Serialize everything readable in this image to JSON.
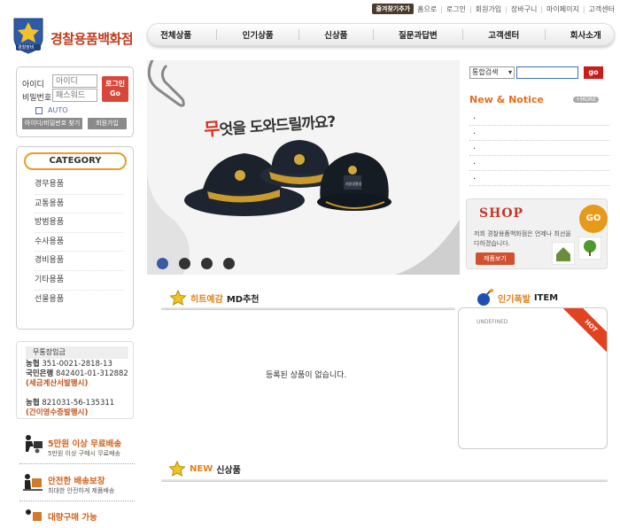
{
  "util_nav": {
    "favorite": "즐겨찾기추가",
    "items": [
      "홈으로",
      "로그인",
      "회원가입",
      "장바구니",
      "마이페이지",
      "고객센터"
    ]
  },
  "logo": {
    "badge_text": "경찰장비",
    "site_name": "경찰용품백화점"
  },
  "nav": [
    "전체상품",
    "인기상품",
    "신상품",
    "질문과답변",
    "고객센터",
    "회사소개"
  ],
  "login": {
    "id_label": "아이디",
    "id_placeholder": "아이디",
    "pw_label": "비밀번호",
    "pw_placeholder": "패스워드",
    "login_button_1": "로그인",
    "login_button_2": "Go",
    "auto": "AUTO",
    "find_button": "아이디/비밀번호 찾기",
    "join_button": "회원가입"
  },
  "category": {
    "title": "CATEGORY",
    "items": [
      "경무용품",
      "교통용품",
      "방범용품",
      "수사용품",
      "경비용품",
      "기타용품",
      "선물용품"
    ]
  },
  "bank": {
    "title": "무통장입금",
    "nh1": "농협",
    "nh1_num": "351-0021-2818-13",
    "km": "국민은행",
    "km_num": "842401-01-312882",
    "note1": "(세금계산서발행시)",
    "nh2": "농협",
    "nh2_num": "821031-56-135311",
    "note2": "(간이영수증발행시)"
  },
  "services": [
    {
      "title": "5만원 이상 무료배송",
      "sub": "5만원 이상 구매시 무료배송"
    },
    {
      "title": "안전한 배송보장",
      "sub": "최대한 안전하게 제품배송"
    },
    {
      "title": "대량구매 가능",
      "sub": ""
    }
  ],
  "banner": {
    "headline_first": "무",
    "headline_rest": "엇을 도와드릴까요?",
    "hat_badge": "지방경찰청"
  },
  "search": {
    "select": "통합검색",
    "go": "go"
  },
  "news": {
    "title": "New & Notice",
    "more": "+MORE",
    "items": [
      ".",
      ".",
      ".",
      ".",
      "."
    ]
  },
  "shop": {
    "title": "SHOP",
    "go": "GO",
    "desc": "저희 경찰용품백화점은 언제나 최선을 다하겠습니다.",
    "button": "제품보기"
  },
  "md": {
    "title_o": "히트예감",
    "title": "MD추천",
    "empty": "등록된 상품이 없습니다."
  },
  "hot": {
    "title_o": "인기폭발",
    "title": "ITEM",
    "ribbon": "HOT",
    "placeholder": "UNDEFINED"
  },
  "newitems": {
    "title_o": "NEW",
    "title": "신상품"
  }
}
